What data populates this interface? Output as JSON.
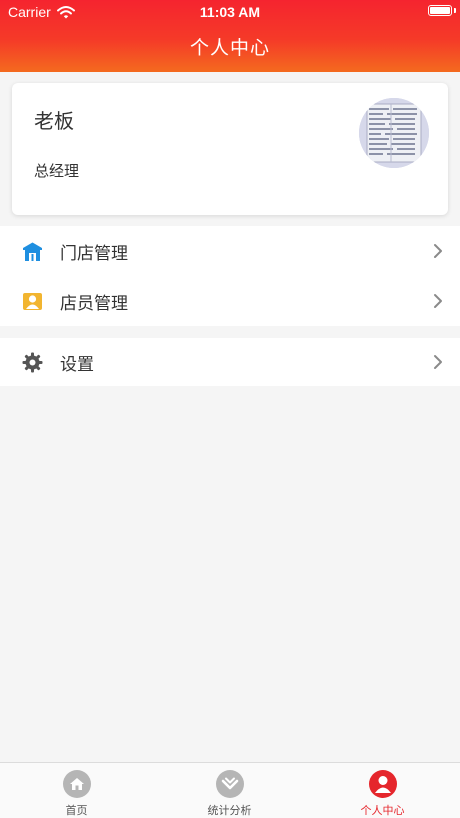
{
  "status_bar": {
    "carrier": "Carrier",
    "time": "11:03 AM",
    "battery_level": 1.0
  },
  "nav": {
    "title": "个人中心"
  },
  "profile": {
    "name": "老板",
    "role": "总经理"
  },
  "menu": {
    "store_management": {
      "label": "门店管理",
      "icon": "store-icon"
    },
    "staff_management": {
      "label": "店员管理",
      "icon": "staff-icon"
    },
    "settings": {
      "label": "设置",
      "icon": "gear-icon"
    }
  },
  "tabs": [
    {
      "label": "首页",
      "icon": "home-icon",
      "active": false
    },
    {
      "label": "统计分析",
      "icon": "chart-icon",
      "active": false
    },
    {
      "label": "个人中心",
      "icon": "person-icon",
      "active": true
    }
  ],
  "colors": {
    "header_top": "#f5242f",
    "header_bottom": "#f46a1f",
    "accent": "#e5262c",
    "store_icon": "#1f8fe0",
    "staff_icon": "#f2b530",
    "inactive_tab_icon": "#b5b5b5"
  }
}
